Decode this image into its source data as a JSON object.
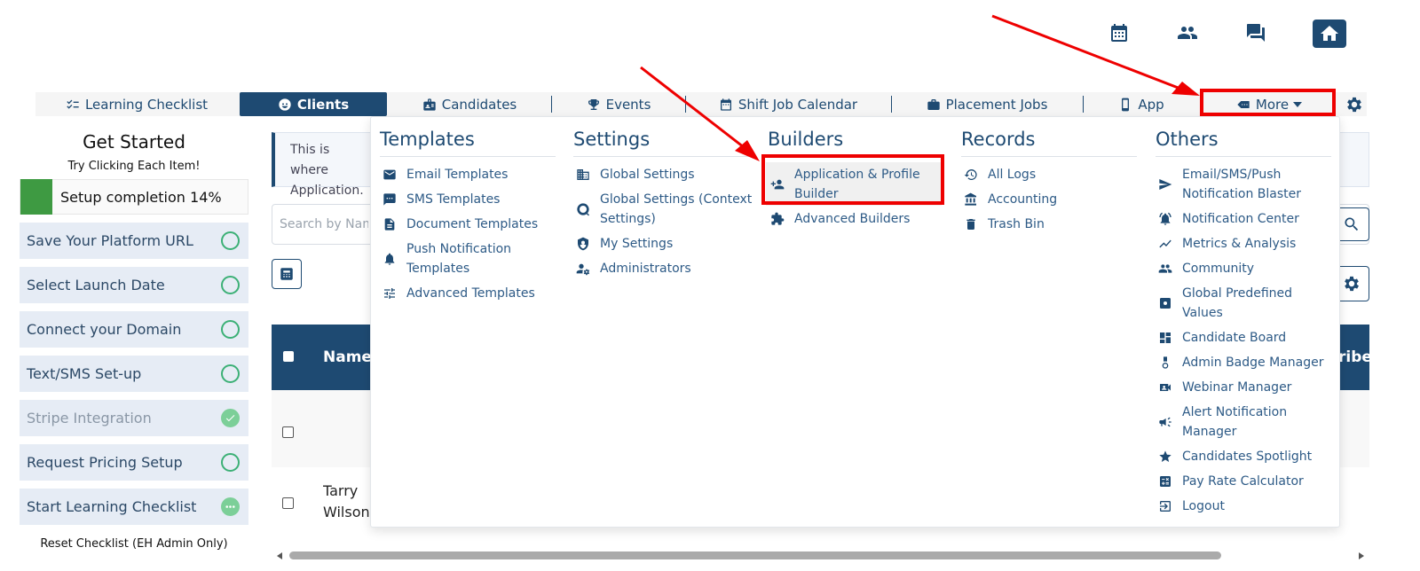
{
  "topbar": {
    "icons": [
      "calendar-icon",
      "people-icon",
      "chat-icon",
      "home-icon"
    ]
  },
  "nav": {
    "items": [
      {
        "label": "Learning Checklist",
        "icon": "checklist-icon"
      },
      {
        "label": "Clients",
        "icon": "face-icon",
        "active": true
      },
      {
        "label": "Candidates",
        "icon": "badge-icon"
      },
      {
        "label": "Events",
        "icon": "trophy-icon"
      },
      {
        "label": "Shift Job Calendar",
        "icon": "calendar-icon"
      },
      {
        "label": "Placement Jobs",
        "icon": "briefcase-icon"
      },
      {
        "label": "App",
        "icon": "phone-icon"
      },
      {
        "label": "More",
        "icon": "tag-icon"
      }
    ]
  },
  "sidebar": {
    "title": "Get Started",
    "subtitle": "Try Clicking Each Item!",
    "progress_label": "Setup completion 14%",
    "progress_value": 14,
    "tasks": [
      {
        "label": "Save Your Platform URL",
        "status": "todo"
      },
      {
        "label": "Select Launch Date",
        "status": "todo"
      },
      {
        "label": "Connect your Domain",
        "status": "todo"
      },
      {
        "label": "Text/SMS Set-up",
        "status": "todo"
      },
      {
        "label": "Stripe Integration",
        "status": "done"
      },
      {
        "label": "Request Pricing Setup",
        "status": "todo"
      },
      {
        "label": "Start Learning Checklist",
        "status": "in-progress"
      }
    ],
    "reset_label": "Reset Checklist (EH Admin Only)"
  },
  "main": {
    "info_text": "This is where Application.",
    "search_placeholder": "Search by Name",
    "table": {
      "header_name": "Name",
      "header_right": "ribed",
      "rows": [
        {
          "name": ""
        },
        {
          "name": "Tarry Wilson"
        }
      ]
    }
  },
  "dropdown": {
    "columns": [
      {
        "heading": "Templates",
        "items": [
          {
            "label": "Email Templates",
            "icon": "mail-icon"
          },
          {
            "label": "SMS Templates",
            "icon": "sms-icon"
          },
          {
            "label": "Document Templates",
            "icon": "document-icon"
          },
          {
            "label": "Push Notification Templates",
            "icon": "bell-icon"
          },
          {
            "label": "Advanced Templates",
            "icon": "sliders-icon"
          }
        ]
      },
      {
        "heading": "Settings",
        "items": [
          {
            "label": "Global Settings",
            "icon": "building-icon"
          },
          {
            "label": "Global Settings (Context Settings)",
            "icon": "globe-search-icon"
          },
          {
            "label": "My Settings",
            "icon": "user-shield-icon"
          },
          {
            "label": "Administrators",
            "icon": "user-gear-icon"
          }
        ]
      },
      {
        "heading": "Builders",
        "items": [
          {
            "label": "Application & Profile Builder",
            "icon": "person-add-icon",
            "highlighted": true
          },
          {
            "label": "Advanced Builders",
            "icon": "puzzle-icon"
          }
        ]
      },
      {
        "heading": "Records",
        "items": [
          {
            "label": "All Logs",
            "icon": "history-icon"
          },
          {
            "label": "Accounting",
            "icon": "bank-icon"
          },
          {
            "label": "Trash Bin",
            "icon": "trash-icon"
          }
        ]
      },
      {
        "heading": "Others",
        "items": [
          {
            "label": "Email/SMS/Push Notification Blaster",
            "icon": "send-icon"
          },
          {
            "label": "Notification Center",
            "icon": "alarm-icon"
          },
          {
            "label": "Metrics & Analysis",
            "icon": "chart-line-icon"
          },
          {
            "label": "Community",
            "icon": "people-icon"
          },
          {
            "label": "Global Predefined Values",
            "icon": "settings-box-icon"
          },
          {
            "label": "Candidate Board",
            "icon": "dashboard-icon"
          },
          {
            "label": "Admin Badge Manager",
            "icon": "medal-icon"
          },
          {
            "label": "Webinar Manager",
            "icon": "video-person-icon"
          },
          {
            "label": "Alert Notification Manager",
            "icon": "megaphone-icon"
          },
          {
            "label": "Candidates Spotlight",
            "icon": "star-icon"
          },
          {
            "label": "Pay Rate Calculator",
            "icon": "calculator-icon"
          },
          {
            "label": "Logout",
            "icon": "logout-icon"
          }
        ]
      }
    ]
  },
  "colors": {
    "primary": "#1e4a72",
    "accent_green": "#3e9a42",
    "annotation_red": "#ee0000"
  }
}
